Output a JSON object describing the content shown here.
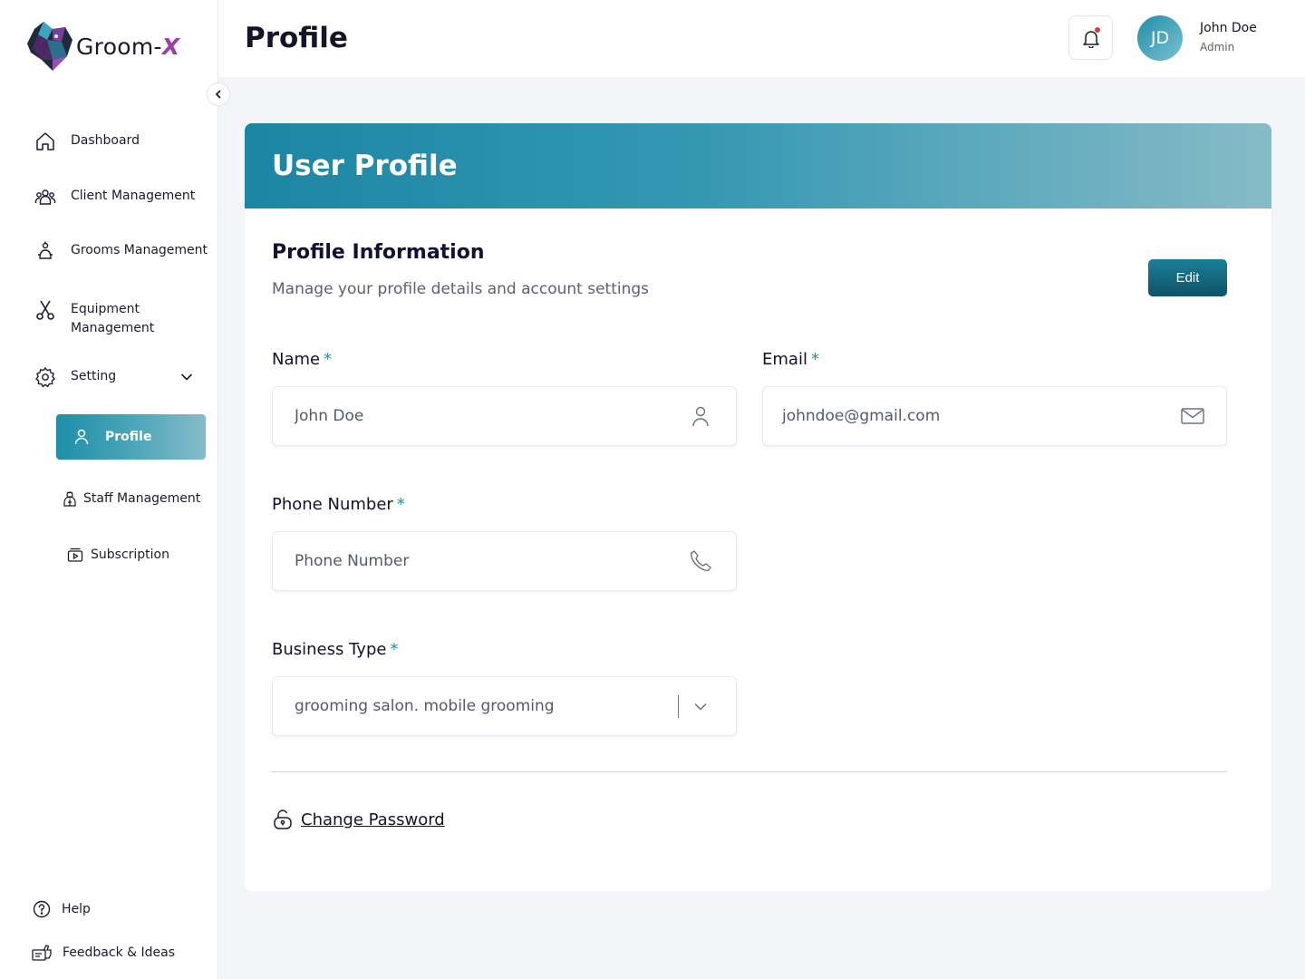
{
  "app": {
    "logo_text_main": "Groom-",
    "logo_text_accent": "X"
  },
  "sidebar": {
    "nav": [
      {
        "label": "Dashboard",
        "icon": "home-icon"
      },
      {
        "label": "Client Management",
        "icon": "users-icon"
      },
      {
        "label": "Grooms Management",
        "icon": "groom-icon"
      },
      {
        "label": "Equipment\nManagement",
        "icon": "scissors-icon"
      },
      {
        "label": "Setting",
        "icon": "gear-icon"
      }
    ],
    "setting_sub": [
      {
        "label": "Profile",
        "icon": "user-icon",
        "active": true
      },
      {
        "label": "Staff Management",
        "icon": "staff-icon"
      },
      {
        "label": "Subscription",
        "icon": "subscription-icon"
      }
    ],
    "footer": [
      {
        "label": "Help",
        "icon": "help-icon"
      },
      {
        "label": "Feedback & Ideas",
        "icon": "feedback-icon"
      }
    ]
  },
  "header": {
    "title": "Profile",
    "user": {
      "initials": "JD",
      "name": "John Doe",
      "role": "Admin"
    }
  },
  "card": {
    "banner_title": "User Profile",
    "section_title": "Profile Information",
    "section_subtitle": "Manage your profile details and account settings",
    "edit_label": "Edit",
    "fields": {
      "name": {
        "label": "Name",
        "required": "*",
        "value": "John Doe"
      },
      "email": {
        "label": "Email",
        "required": "*",
        "value": "johndoe@gmail.com"
      },
      "phone": {
        "label": "Phone Number",
        "required": "*",
        "value": "",
        "placeholder": "Phone Number"
      },
      "business_type": {
        "label": "Business Type",
        "required": "*",
        "value": "grooming salon. mobile grooming"
      }
    },
    "change_password_label": "Change Password"
  },
  "colors": {
    "accent": "#1e8fa8",
    "accent_dark": "#0f5368",
    "logo_accent": "#9b3fa6",
    "notification_dot": "#e23b3b"
  }
}
